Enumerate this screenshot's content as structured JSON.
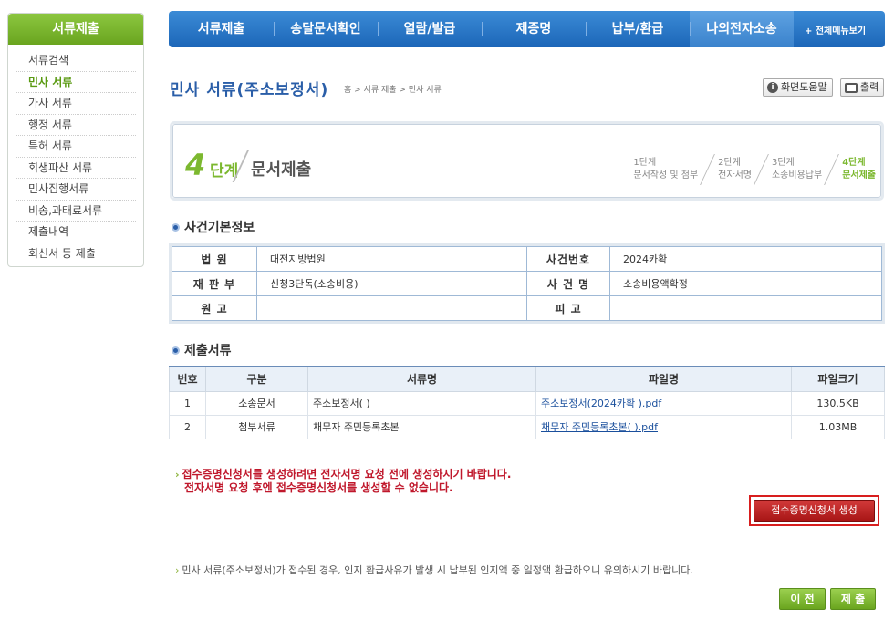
{
  "sidebar": {
    "title": "서류제출",
    "items": [
      {
        "label": "서류검색"
      },
      {
        "label": "민사 서류",
        "active": true
      },
      {
        "label": "가사 서류"
      },
      {
        "label": "행정 서류"
      },
      {
        "label": "특허 서류"
      },
      {
        "label": "회생파산 서류"
      },
      {
        "label": "민사집행서류"
      },
      {
        "label": "비송,과태료서류"
      },
      {
        "label": "제출내역"
      },
      {
        "label": "회신서 등 제출"
      }
    ]
  },
  "topnav": {
    "items": [
      "서류제출",
      "송달문서확인",
      "열람/발급",
      "제증명",
      "납부/환급",
      "나의전자소송"
    ],
    "all_menu": "+ 전체메뉴보기"
  },
  "page": {
    "title": "민사 서류(주소보정서)",
    "breadcrumb": "홈 > 서류 제출 > 민사 서류",
    "help_label": "화면도움말",
    "print_label": "출력"
  },
  "stepbox": {
    "num": "4",
    "word": "단계",
    "name": "문서제출",
    "steps": [
      {
        "l1": "1단계",
        "l2": "문서작성 및 첨부"
      },
      {
        "l1": "2단계",
        "l2": "전자서명"
      },
      {
        "l1": "3단계",
        "l2": "소송비용납부"
      },
      {
        "l1": "4단계",
        "l2": "문서제출"
      }
    ]
  },
  "case_info": {
    "heading": "사건기본정보",
    "court_label": "법 원",
    "court": "대전지방법원",
    "case_no_label": "사건번호",
    "case_no": "2024카확",
    "division_label": "재 판 부",
    "division": "신청3단독(소송비용)",
    "case_name_label": "사 건 명",
    "case_name": "소송비용액확정",
    "plaintiff_label": "원 고",
    "plaintiff": "",
    "defendant_label": "피 고",
    "defendant": ""
  },
  "files": {
    "heading": "제출서류",
    "headers": [
      "번호",
      "구분",
      "서류명",
      "파일명",
      "파일크기"
    ],
    "rows": [
      {
        "no": "1",
        "type": "소송문서",
        "doc": "주소보정서(        )",
        "file": "주소보정서(2024카확        ).pdf",
        "size": "130.5KB"
      },
      {
        "no": "2",
        "type": "첨부서류",
        "doc": "채무자 주민등록초본",
        "file": "채무자 주민등록초본(        ).pdf",
        "size": "1.03MB"
      }
    ]
  },
  "warning": {
    "line1": "접수증명신청서를 생성하려면 전자서명 요청 전에 생성하시기 바랍니다.",
    "line2": "전자서명 요청 후엔 접수증명신청서를 생성할 수 없습니다.",
    "button": "접수증명신청서 생성"
  },
  "notice": "민사 서류(주소보정서)가 접수된 경우, 인지 환급사유가 발생 시 납부된 인지액 중 일정액 환급하오니 유의하시기 바랍니다.",
  "buttons": {
    "prev": "이 전",
    "submit": "제 출"
  }
}
